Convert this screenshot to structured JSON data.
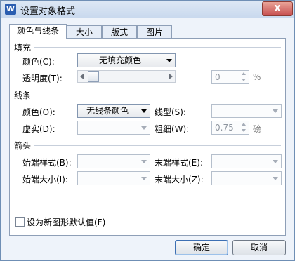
{
  "window": {
    "title": "设置对象格式",
    "app_icon": "W",
    "close_label": "X"
  },
  "tabs": [
    {
      "label": "颜色与线条",
      "active": true
    },
    {
      "label": "大小",
      "active": false
    },
    {
      "label": "版式",
      "active": false
    },
    {
      "label": "图片",
      "active": false
    }
  ],
  "fill": {
    "section": "填充",
    "color_label": "颜色(C):",
    "color_value": "无填充颜色",
    "transparency_label": "透明度(T):",
    "transparency_value": "0",
    "transparency_unit": "%"
  },
  "line": {
    "section": "线条",
    "color_label": "颜色(O):",
    "color_value": "无线条颜色",
    "style_label": "线型(S):",
    "dash_label": "虚实(D):",
    "weight_label": "粗细(W):",
    "weight_value": "0.75",
    "weight_unit": "磅"
  },
  "arrows": {
    "section": "箭头",
    "begin_style_label": "始端样式(B):",
    "end_style_label": "末端样式(E):",
    "begin_size_label": "始端大小(I):",
    "end_size_label": "末端大小(Z):"
  },
  "default_checkbox_label": "设为新图形默认值(F)",
  "buttons": {
    "ok": "确定",
    "cancel": "取消"
  }
}
